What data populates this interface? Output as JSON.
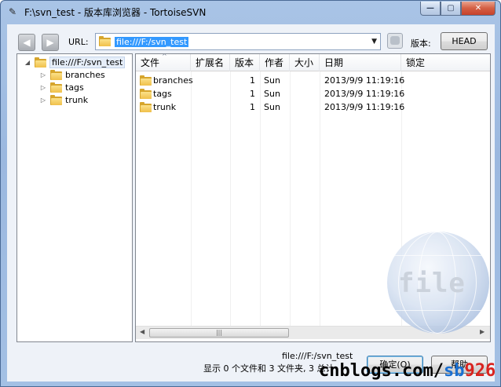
{
  "window": {
    "title": "F:\\svn_test - 版本库浏览器 - TortoiseSVN",
    "app_icon": "tortoise-icon",
    "minimize_glyph": "—",
    "maximize_glyph": "▢",
    "close_glyph": "✕"
  },
  "toolbar": {
    "back_icon": "back-arrow-icon",
    "forward_icon": "forward-arrow-icon",
    "back_glyph": "◀",
    "forward_glyph": "▶",
    "url_label": "URL:",
    "url_value": "file:///F:/svn_test",
    "dropdown_glyph": "▼",
    "revision_label": "版本:",
    "revision_value": "HEAD"
  },
  "tree": {
    "root": {
      "label": "file:///F:/svn_test",
      "expanded": true
    },
    "children": [
      {
        "label": "branches"
      },
      {
        "label": "tags"
      },
      {
        "label": "trunk"
      }
    ],
    "expand_glyph": "◢",
    "collapsed_glyph": "▷"
  },
  "list": {
    "columns": [
      "文件",
      "扩展名",
      "版本",
      "作者",
      "大小",
      "日期",
      "锁定"
    ],
    "sort_glyph": "^",
    "rows": [
      {
        "name": "branches",
        "ext": "",
        "revision": "1",
        "author": "Sun",
        "size": "",
        "date": "2013/9/9 11:19:16",
        "lock": ""
      },
      {
        "name": "tags",
        "ext": "",
        "revision": "1",
        "author": "Sun",
        "size": "",
        "date": "2013/9/9 11:19:16",
        "lock": ""
      },
      {
        "name": "trunk",
        "ext": "",
        "revision": "1",
        "author": "Sun",
        "size": "",
        "date": "2013/9/9 11:19:16",
        "lock": ""
      }
    ],
    "scroll_left_glyph": "◀",
    "scroll_right_glyph": "▶",
    "scroll_grip_glyph": "|||"
  },
  "watermark": {
    "text": "file"
  },
  "status": {
    "path": "file:///F:/svn_test",
    "count": "显示 0 个文件和 3 文件夹, 3 总计"
  },
  "buttons": {
    "ok": "确定(O)",
    "help": "帮助"
  },
  "overlay": {
    "part1": "cnblogs.com/",
    "part2": "sb",
    "part3": "926"
  },
  "colors": {
    "selection": "#3399ff",
    "folder": "#f0c04a",
    "brand_blue": "#1a6fd1",
    "brand_red": "#d9231f"
  }
}
